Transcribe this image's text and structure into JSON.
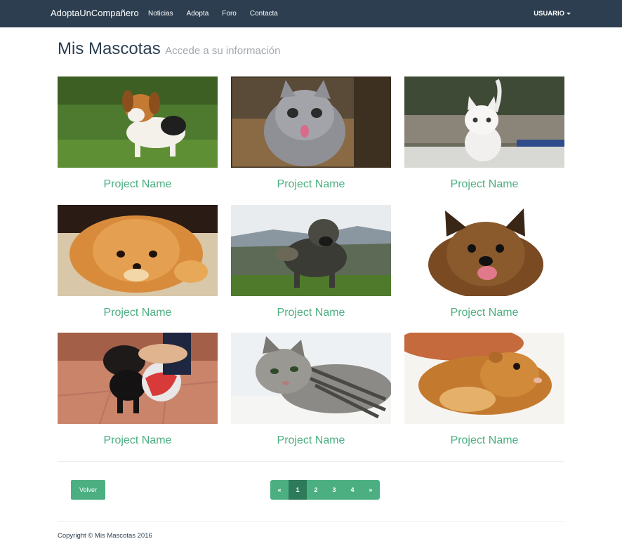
{
  "navbar": {
    "brand": "AdoptaUnCompañero",
    "links": [
      "Noticias",
      "Adopta",
      "Foro",
      "Contacta"
    ],
    "user_label": "USUARIO"
  },
  "header": {
    "title": "Mis Mascotas",
    "subtitle": "Accede a su información"
  },
  "pets": [
    {
      "name": "Project Name",
      "photo": "beagle-puppy-photo"
    },
    {
      "name": "Project Name",
      "photo": "grey-kitten-photo"
    },
    {
      "name": "Project Name",
      "photo": "white-kitten-photo"
    },
    {
      "name": "Project Name",
      "photo": "pomeranian-photo"
    },
    {
      "name": "Project Name",
      "photo": "shepherd-dog-photo"
    },
    {
      "name": "Project Name",
      "photo": "terrier-photo"
    },
    {
      "name": "Project Name",
      "photo": "puppy-with-ball-photo"
    },
    {
      "name": "Project Name",
      "photo": "tabby-cat-photo"
    },
    {
      "name": "Project Name",
      "photo": "hamster-photo"
    }
  ],
  "actions": {
    "back_label": "Volver"
  },
  "pagination": {
    "prev": "«",
    "pages": [
      "1",
      "2",
      "3",
      "4"
    ],
    "active_page": "1",
    "next": "»"
  },
  "footer": {
    "copyright": "Copyright © Mis Mascotas 2016"
  },
  "colors": {
    "navbar_bg": "#2c3e50",
    "accent": "#4caf82",
    "active_page": "#2d7b5a"
  }
}
